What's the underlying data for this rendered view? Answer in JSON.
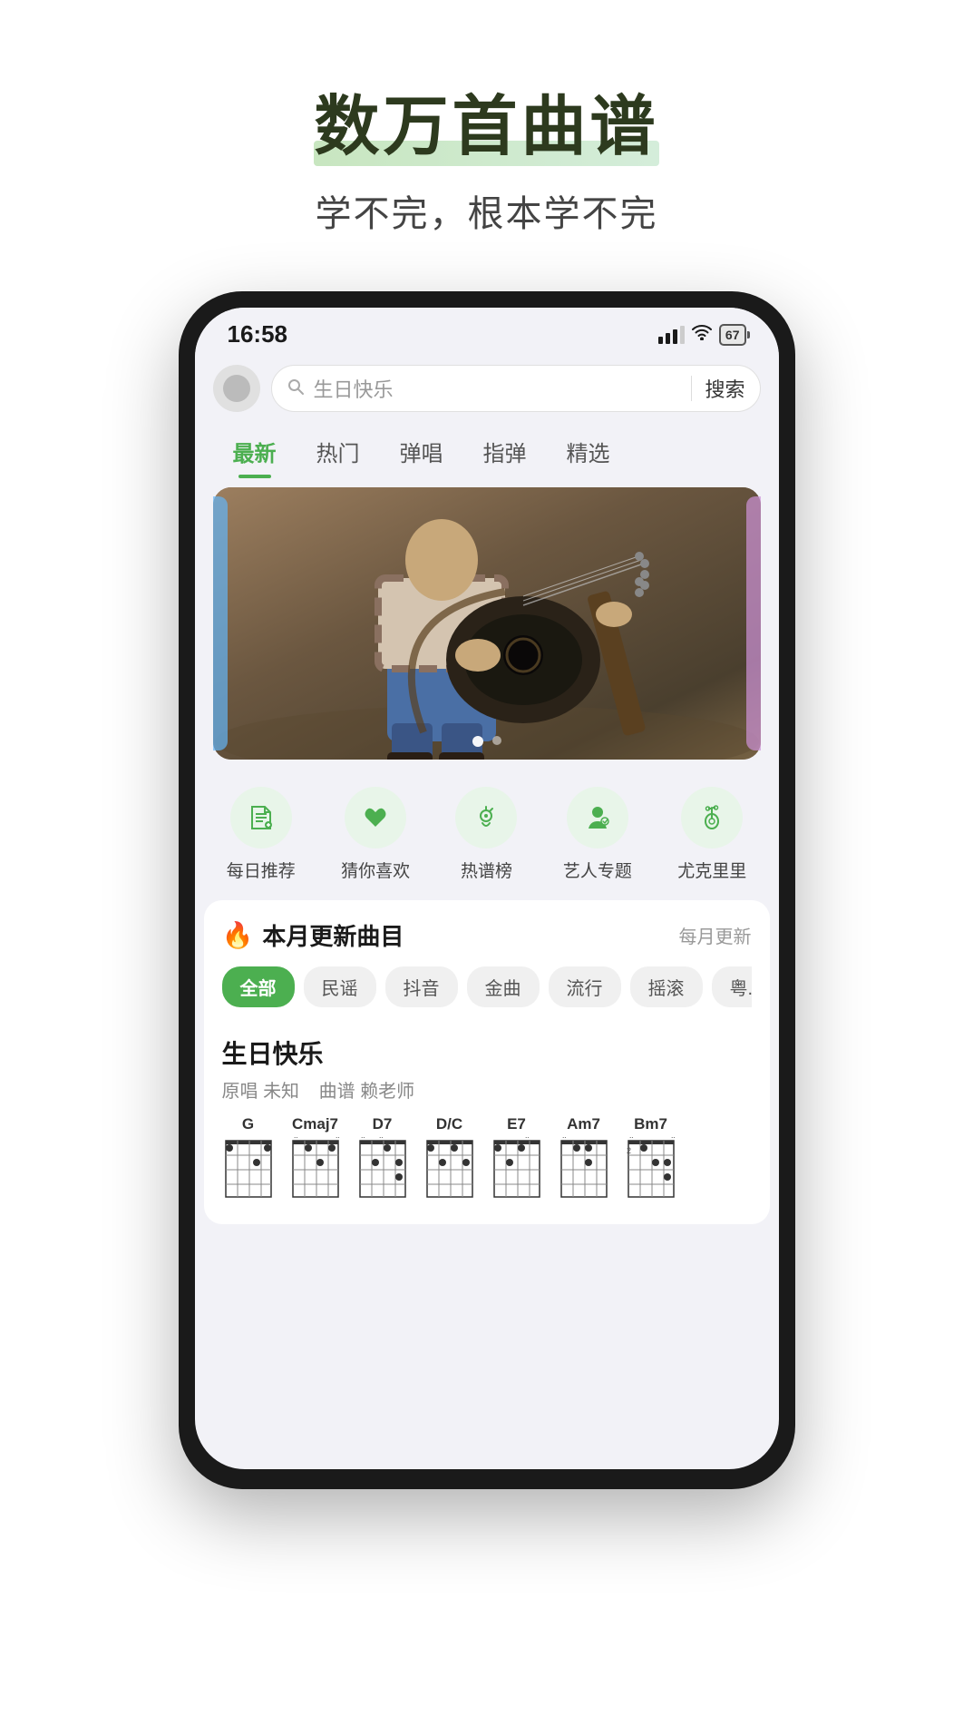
{
  "hero": {
    "title": "数万首曲谱",
    "subtitle": "学不完，根本学不完"
  },
  "phone": {
    "statusBar": {
      "time": "16:58",
      "battery": "67"
    },
    "search": {
      "placeholder": "生日快乐",
      "searchBtn": "搜索"
    },
    "tabs": [
      {
        "label": "最新",
        "active": true
      },
      {
        "label": "热门",
        "active": false
      },
      {
        "label": "弹唱",
        "active": false
      },
      {
        "label": "指弹",
        "active": false
      },
      {
        "label": "精选",
        "active": false
      }
    ],
    "quickActions": [
      {
        "label": "每日推荐",
        "icon": "♫"
      },
      {
        "label": "猜你喜欢",
        "icon": "♥"
      },
      {
        "label": "热谱榜",
        "icon": "♪"
      },
      {
        "label": "艺人专题",
        "icon": "👤"
      },
      {
        "label": "尤克里里",
        "icon": "🎸"
      }
    ],
    "monthlySection": {
      "title": "本月更新曲目",
      "more": "每月更新",
      "filters": [
        {
          "label": "全部",
          "active": true
        },
        {
          "label": "民谣",
          "active": false
        },
        {
          "label": "抖音",
          "active": false
        },
        {
          "label": "金曲",
          "active": false
        },
        {
          "label": "流行",
          "active": false
        },
        {
          "label": "摇滚",
          "active": false
        },
        {
          "label": "粤...",
          "active": false
        }
      ],
      "song": {
        "title": "生日快乐",
        "metaLabel1": "原唱",
        "metaValue1": "未知",
        "metaLabel2": "曲谱",
        "metaValue2": "赖老师"
      },
      "chords": [
        {
          "name": "G"
        },
        {
          "name": "Cmaj7"
        },
        {
          "name": "D7"
        },
        {
          "name": "D/C"
        },
        {
          "name": "E7"
        },
        {
          "name": "Am7"
        },
        {
          "name": "Bm7"
        }
      ]
    }
  }
}
